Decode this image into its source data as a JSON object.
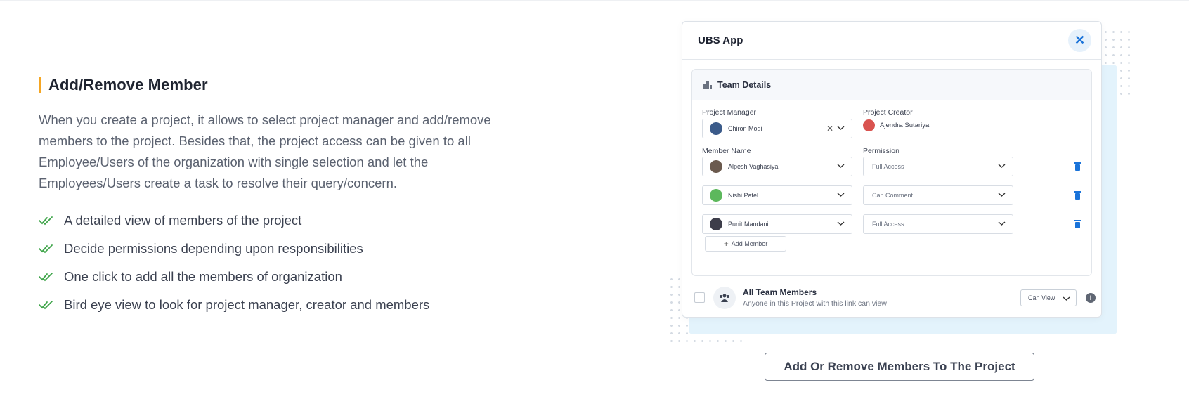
{
  "section": {
    "title": "Add/Remove Member",
    "description": "When you create a project, it allows to select project manager and add/remove members to the project. Besides that, the project access can be given to all Employee/Users of the organization with single selection and let the Employees/Users create a task to resolve their query/concern.",
    "features": [
      "A detailed view of members of the project",
      "Decide permissions depending upon responsibilities",
      "One click to add all the members of organization",
      "Bird eye view to look for project manager, creator and members"
    ]
  },
  "modal": {
    "title": "UBS App",
    "close_icon": "close-icon",
    "team_details": "Team Details",
    "project_manager_label": "Project Manager",
    "project_manager": "Chiron Modi",
    "project_creator_label": "Project Creator",
    "project_creator": "Ajendra Sutariya",
    "member_name_label": "Member Name",
    "permission_label": "Permission",
    "members": [
      {
        "name": "Alpesh Vaghasiya",
        "permission": "Full Access"
      },
      {
        "name": "Nishi Patel",
        "permission": "Can Comment"
      },
      {
        "name": "Punit Mandani",
        "permission": "Full Access"
      }
    ],
    "add_member": "Add Member",
    "all_team_title": "All Team Members",
    "all_team_sub": "Anyone in this Project with this link can view",
    "access_select": "Can View"
  },
  "cta_label": "Add Or Remove Members To The Project",
  "colors": {
    "accent_bar": "#f5a623",
    "check_green": "#3fa54a",
    "link_blue": "#1a73d9",
    "panel_bg": "#e3f3fc"
  }
}
